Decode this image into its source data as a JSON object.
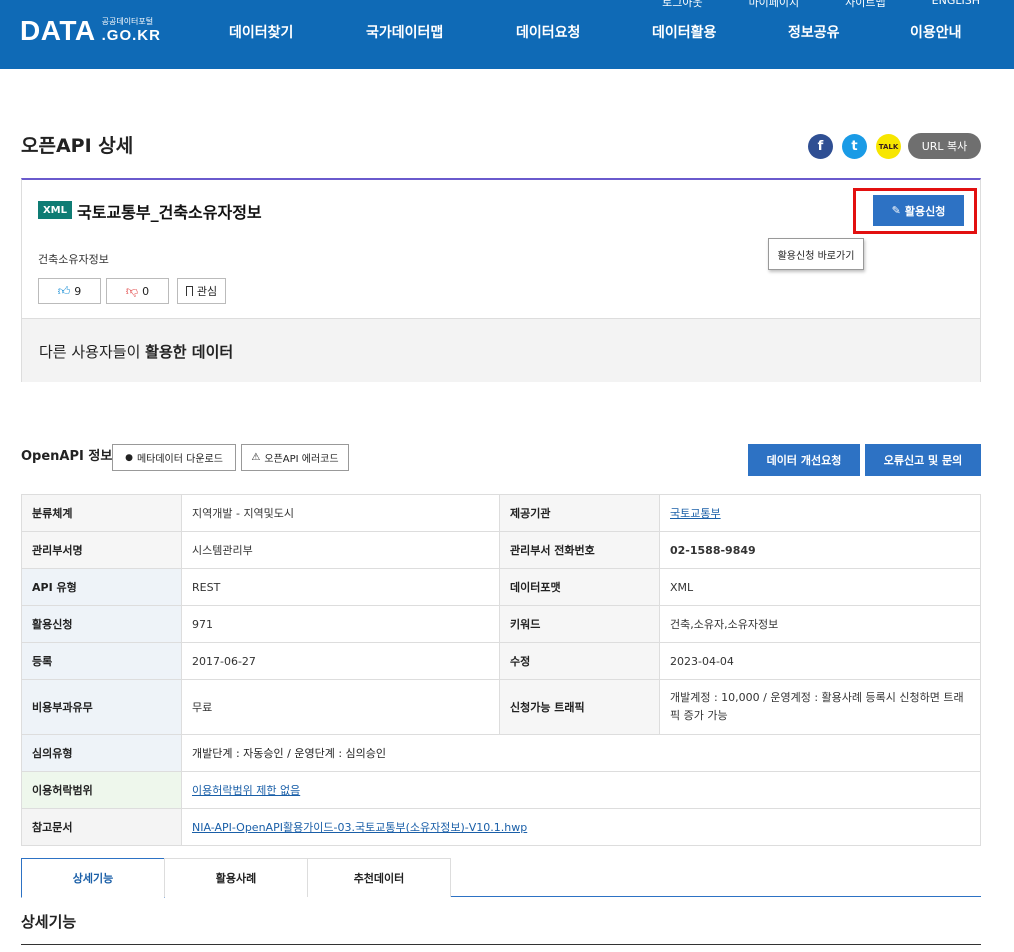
{
  "header": {
    "util": [
      "로그아웃",
      "마이페이지",
      "사이트맵",
      "ENGLISH"
    ],
    "logo_main": "DATA",
    "logo_small": "공공데이터포털",
    "logo_domain": ".GO.KR",
    "nav": [
      "데이터찾기",
      "국가데이터맵",
      "데이터요청",
      "데이터활용",
      "정보공유",
      "이용안내"
    ]
  },
  "page": {
    "title": "오픈API 상세",
    "share": {
      "facebook": "f",
      "twitter": "t",
      "kakao": "TALK",
      "url_copy": "URL 복사"
    }
  },
  "dataset": {
    "format_badge": "XML",
    "title": "국토교통부_건축소유자정보",
    "description": "건축소유자정보",
    "likes": "9",
    "dislikes": "0",
    "favorite": "관심",
    "apply_button": "활용신청",
    "apply_tooltip": "활용신청 바로가기",
    "others_prefix": "다른 사용자들이 ",
    "others_bold": "활용한 데이터"
  },
  "openapi": {
    "title": "OpenAPI 정보",
    "metadata_download": "메타데이터 다운로드",
    "error_code": "오픈API 에러코드",
    "improve_request": "데이터 개선요청",
    "report": "오류신고 및 문의",
    "rows": [
      {
        "k1": "분류체계",
        "v1": "지역개발 - 지역및도시",
        "k2": "제공기관",
        "v2": "국토교통부"
      },
      {
        "k1": "관리부서명",
        "v1": "시스템관리부",
        "k2": "관리부서 전화번호",
        "v2": "02-1588-9849"
      },
      {
        "k1": "API 유형",
        "v1": "REST",
        "k2": "데이터포맷",
        "v2": "XML"
      },
      {
        "k1": "활용신청",
        "v1": "971",
        "k2": "키워드",
        "v2": "건축,소유자,소유자정보"
      },
      {
        "k1": "등록",
        "v1": "2017-06-27",
        "k2": "수정",
        "v2": "2023-04-04"
      },
      {
        "k1": "비용부과유무",
        "v1": "무료",
        "k2": "신청가능 트래픽",
        "v2": "개발계정 : 10,000 / 운영계정 : 활용사례 등록시 신청하면 트래픽 증가 가능"
      }
    ],
    "review_type_label": "심의유형",
    "review_type_value": "개발단계 : 자동승인 / 운영단계 : 심의승인",
    "license_label": "이용허락범위",
    "license_value": "이용허락범위 제한 없음",
    "ref_doc_label": "참고문서",
    "ref_doc_value": "NIA-API-OpenAPI활용가이드-03.국토교통부(소유자정보)-V10.1.hwp"
  },
  "tabs": [
    "상세기능",
    "활용사례",
    "추천데이터"
  ],
  "section_title": "상세기능"
}
